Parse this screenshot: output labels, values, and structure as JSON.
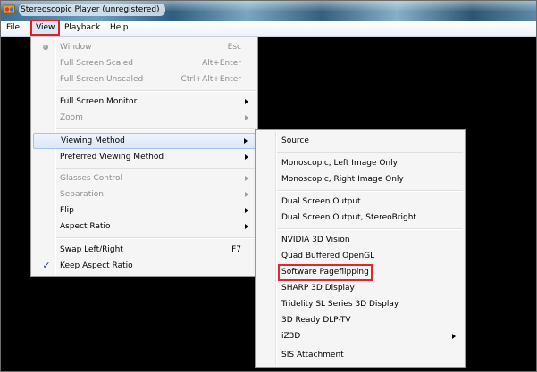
{
  "window": {
    "title": "Stereoscopic Player (unregistered)",
    "icon": "stereoscopic-player-app-icon"
  },
  "menubar": {
    "items": [
      "File",
      "View",
      "Playback",
      "Help"
    ],
    "active": "View"
  },
  "view_menu": {
    "items": [
      {
        "label": "Window",
        "shortcut": "Esc",
        "disabled": true,
        "marker": "radio"
      },
      {
        "label": "Full Screen Scaled",
        "shortcut": "Alt+Enter",
        "disabled": true
      },
      {
        "label": "Full Screen Unscaled",
        "shortcut": "Ctrl+Alt+Enter",
        "disabled": true
      },
      {
        "label": "Full Screen Monitor",
        "submenu": true
      },
      {
        "label": "Zoom",
        "disabled": true,
        "submenu": true
      },
      {
        "label": "Viewing Method",
        "submenu": true,
        "highlighted": true
      },
      {
        "label": "Preferred Viewing Method",
        "submenu": true
      },
      {
        "label": "Glasses Control",
        "disabled": true,
        "submenu": true
      },
      {
        "label": "Separation",
        "disabled": true,
        "submenu": true
      },
      {
        "label": "Flip",
        "submenu": true
      },
      {
        "label": "Aspect Ratio",
        "submenu": true
      },
      {
        "label": "Swap Left/Right",
        "shortcut": "F7"
      },
      {
        "label": "Keep Aspect Ratio",
        "checked": true
      }
    ],
    "check_glyph": "✓"
  },
  "viewing_method_submenu": {
    "items": [
      {
        "label": "Source"
      },
      {
        "label": "Monoscopic, Left Image Only"
      },
      {
        "label": "Monoscopic, Right Image Only"
      },
      {
        "label": "Dual Screen Output"
      },
      {
        "label": "Dual Screen Output, StereoBright"
      },
      {
        "label": "NVIDIA 3D Vision"
      },
      {
        "label": "Quad Buffered OpenGL"
      },
      {
        "label": "Software Pageflipping",
        "annotated": true
      },
      {
        "label": "SHARP 3D Display"
      },
      {
        "label": "Tridelity SL Series 3D Display"
      },
      {
        "label": "3D Ready DLP-TV"
      },
      {
        "label": "iZ3D",
        "submenu": true
      },
      {
        "label": "SIS Attachment"
      }
    ]
  },
  "colors": {
    "annotation": "#e3262b",
    "menu_bg": "#f5f5f5",
    "disabled_text": "#8d8d8d",
    "hover_bg": "#dce8f7"
  }
}
